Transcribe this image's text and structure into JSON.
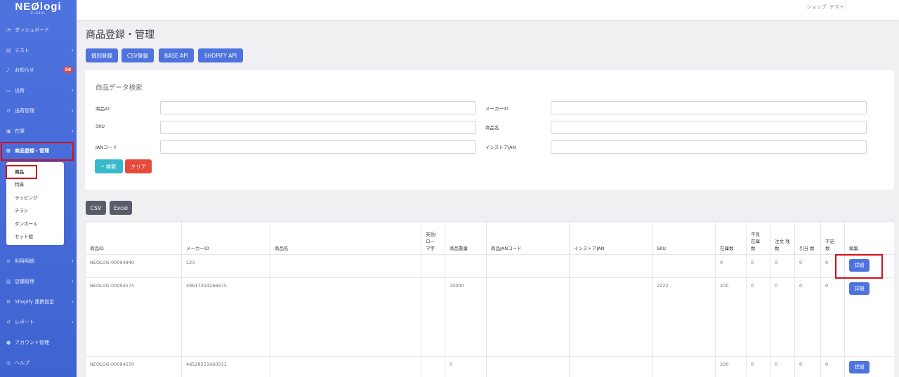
{
  "brand": {
    "name": "NEØlogi",
    "sub": "GLOBAL"
  },
  "sidebar": {
    "items": [
      {
        "label": "ダッシュボード",
        "icon": "dashboard-icon"
      },
      {
        "label": "テスト",
        "icon": "table-icon"
      },
      {
        "label": "お知らせ",
        "icon": "bell-icon",
        "badge": "56"
      },
      {
        "label": "出荷",
        "icon": "truck-icon"
      },
      {
        "label": "出荷管理",
        "icon": "undo-icon"
      },
      {
        "label": "在庫",
        "icon": "warehouse-icon"
      },
      {
        "label": "商品登録・管理",
        "icon": "sitemap-icon"
      },
      {
        "label": "利用明細",
        "icon": "receipt-icon"
      },
      {
        "label": "店舗管理",
        "icon": "store-icon"
      },
      {
        "label": "Shopify 連携設定",
        "icon": "gear-icon"
      },
      {
        "label": "レポート",
        "icon": "undo-icon"
      },
      {
        "label": "アカウント管理",
        "icon": "user-icon"
      },
      {
        "label": "ヘルプ",
        "icon": "help-icon"
      }
    ],
    "submenu": [
      "商品",
      "特典",
      "ラッピング",
      "チラシ",
      "ダンボール",
      "セット組"
    ]
  },
  "topbar": {
    "shop": "ショップ: テスト"
  },
  "page": {
    "title": "商品登録・管理",
    "buttons": [
      "個別登録",
      "CSV登録",
      "BASE API",
      "SHOPIFY API"
    ]
  },
  "search": {
    "title": "商品データ検索",
    "labels": [
      "商品ID",
      "メーカーID",
      "SKU",
      "商品名",
      "JANコード",
      "インストアJAN"
    ],
    "search_button": "検索",
    "clear_button": "クリア"
  },
  "export": {
    "csv": "CSV",
    "excel": "Excel"
  },
  "table": {
    "headers": [
      "商品ID",
      "メーカーID",
      "商品名",
      "英語/ロー マ字",
      "商品重量",
      "商品JANコード",
      "インストアJAN",
      "SKU",
      "在庫数",
      "不良 在庫 数",
      "注文 残数",
      "引当 数",
      "不足 数",
      "編集"
    ],
    "rows": [
      [
        "NEOLOG-00094840",
        "123",
        "",
        "",
        "",
        "",
        "",
        "",
        "0",
        "0",
        "0",
        "0",
        "0"
      ],
      [
        "NEOLOG-00094574",
        "48617294266675",
        "",
        "",
        "10000",
        "",
        "",
        "2222",
        "200",
        "0",
        "0",
        "0",
        "0"
      ],
      [
        "NEOLOG-00094570",
        "48528251060531",
        "",
        "",
        "0",
        "",
        "",
        "",
        "200",
        "0",
        "0",
        "0",
        "0"
      ]
    ],
    "detail_button": "詳細"
  },
  "colors": {
    "primary": "#4e73df",
    "info": "#36b9cc",
    "danger": "#e74a3b",
    "highlight": "#d0101a"
  }
}
